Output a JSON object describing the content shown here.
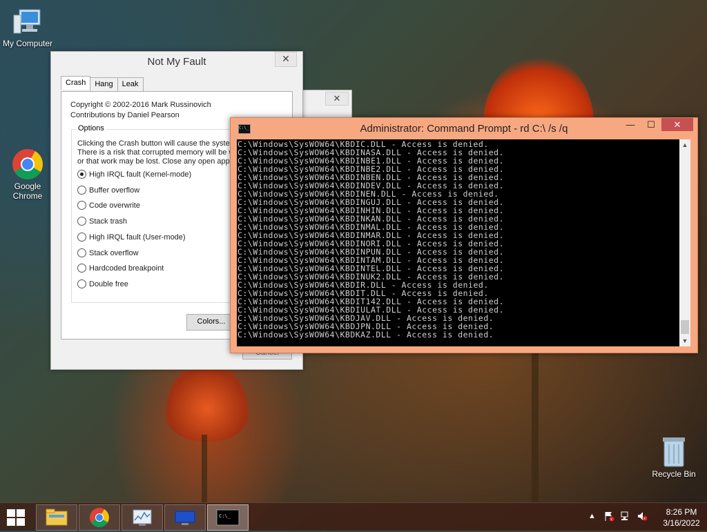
{
  "desktop": {
    "icons": [
      {
        "label": "My Computer"
      },
      {
        "label": "Google Chrome"
      },
      {
        "label": "Recycle Bin"
      }
    ]
  },
  "nmf": {
    "title": "Not My Fault",
    "close": "✕",
    "tabs": [
      "Crash",
      "Hang",
      "Leak"
    ],
    "copyright_line1": "Copyright © 2002-2016 Mark Russinovich",
    "copyright_line2": "Contributions by Daniel Pearson",
    "options_legend": "Options",
    "desc_line1": "Clicking the Crash button will cause the system",
    "desc_line2": "There is a risk that corrupted memory will be w",
    "desc_line3": "or that work may be lost. Close any open appli",
    "options": [
      {
        "label": "High IRQL fault (Kernel-mode)",
        "selected": true
      },
      {
        "label": "Buffer overflow",
        "selected": false
      },
      {
        "label": "Code overwrite",
        "selected": false
      },
      {
        "label": "Stack trash",
        "selected": false
      },
      {
        "label": "High IRQL fault (User-mode)",
        "selected": false
      },
      {
        "label": "Stack overflow",
        "selected": false
      },
      {
        "label": "Hardcoded breakpoint",
        "selected": false
      },
      {
        "label": "Double free",
        "selected": false
      }
    ],
    "colors_button": "Colors...",
    "cancel_button": "Cancel"
  },
  "bgwin": {
    "close": "✕"
  },
  "cmd": {
    "title": "Administrator: Command Prompt - rd  C:\\ /s /q",
    "minimize": "—",
    "maximize": "☐",
    "close": "✕",
    "lines": [
      "C:\\Windows\\SysWOW64\\KBDIC.DLL - Access is denied.",
      "C:\\Windows\\SysWOW64\\KBDINASA.DLL - Access is denied.",
      "C:\\Windows\\SysWOW64\\KBDINBE1.DLL - Access is denied.",
      "C:\\Windows\\SysWOW64\\KBDINBE2.DLL - Access is denied.",
      "C:\\Windows\\SysWOW64\\KBDINBEN.DLL - Access is denied.",
      "C:\\Windows\\SysWOW64\\KBDINDEV.DLL - Access is denied.",
      "C:\\Windows\\SysWOW64\\KBDINEN.DLL - Access is denied.",
      "C:\\Windows\\SysWOW64\\KBDINGUJ.DLL - Access is denied.",
      "C:\\Windows\\SysWOW64\\KBDINHIN.DLL - Access is denied.",
      "C:\\Windows\\SysWOW64\\KBDINKAN.DLL - Access is denied.",
      "C:\\Windows\\SysWOW64\\KBDINMAL.DLL - Access is denied.",
      "C:\\Windows\\SysWOW64\\KBDINMAR.DLL - Access is denied.",
      "C:\\Windows\\SysWOW64\\KBDINORI.DLL - Access is denied.",
      "C:\\Windows\\SysWOW64\\KBDINPUN.DLL - Access is denied.",
      "C:\\Windows\\SysWOW64\\KBDINTAM.DLL - Access is denied.",
      "C:\\Windows\\SysWOW64\\KBDINTEL.DLL - Access is denied.",
      "C:\\Windows\\SysWOW64\\KBDINUK2.DLL - Access is denied.",
      "C:\\Windows\\SysWOW64\\KBDIR.DLL - Access is denied.",
      "C:\\Windows\\SysWOW64\\KBDIT.DLL - Access is denied.",
      "C:\\Windows\\SysWOW64\\KBDIT142.DLL - Access is denied.",
      "C:\\Windows\\SysWOW64\\KBDIULAT.DLL - Access is denied.",
      "C:\\Windows\\SysWOW64\\KBDJAV.DLL - Access is denied.",
      "C:\\Windows\\SysWOW64\\KBDJPN.DLL - Access is denied.",
      "C:\\Windows\\SysWOW64\\KBDKAZ.DLL - Access is denied."
    ]
  },
  "taskbar": {
    "buttons": [
      {
        "name": "file-explorer"
      },
      {
        "name": "google-chrome"
      },
      {
        "name": "performance-monitor"
      },
      {
        "name": "remote-desktop"
      },
      {
        "name": "command-prompt",
        "active": true
      }
    ],
    "time": "8:26 PM",
    "date": "3/16/2022"
  },
  "colors": {
    "cmd_frame": "#f7a881",
    "cmd_close": "#c75050",
    "console_bg": "#000000",
    "console_text": "#d0d0d0"
  }
}
